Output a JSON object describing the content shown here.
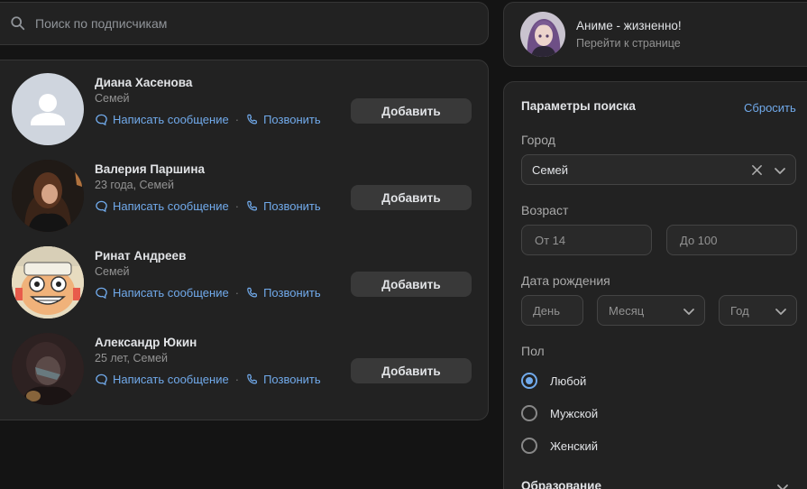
{
  "search": {
    "placeholder": "Поиск по подписчикам",
    "icon": "search-icon"
  },
  "subscribers": [
    {
      "name": "Диана Хасенова",
      "meta": "Семей",
      "message": "Написать сообщение",
      "call": "Позвонить",
      "add": "Добавить"
    },
    {
      "name": "Валерия Паршина",
      "meta": "23 года, Семей",
      "message": "Написать сообщение",
      "call": "Позвонить",
      "add": "Добавить"
    },
    {
      "name": "Ринат Андреев",
      "meta": "Семей",
      "message": "Написать сообщение",
      "call": "Позвонить",
      "add": "Добавить"
    },
    {
      "name": "Александр Юкин",
      "meta": "25 лет, Семей",
      "message": "Написать сообщение",
      "call": "Позвонить",
      "add": "Добавить"
    }
  ],
  "separator": "·",
  "group": {
    "name": "Аниме - жизненно!",
    "link": "Перейти к странице"
  },
  "filters": {
    "title": "Параметры поиска",
    "reset": "Сбросить",
    "city": {
      "label": "Город",
      "value": "Семей"
    },
    "age": {
      "label": "Возраст",
      "from_placeholder": "От 14",
      "to_placeholder": "До 100"
    },
    "birth": {
      "label": "Дата рождения",
      "day": "День",
      "month": "Месяц",
      "year": "Год"
    },
    "gender": {
      "label": "Пол",
      "options": [
        {
          "label": "Любой",
          "checked": true
        },
        {
          "label": "Мужской",
          "checked": false
        },
        {
          "label": "Женский",
          "checked": false
        }
      ]
    },
    "education": "Образование"
  },
  "colors": {
    "accent": "#71aaeb",
    "panel": "#222222",
    "background": "#141414",
    "button": "#393939"
  }
}
